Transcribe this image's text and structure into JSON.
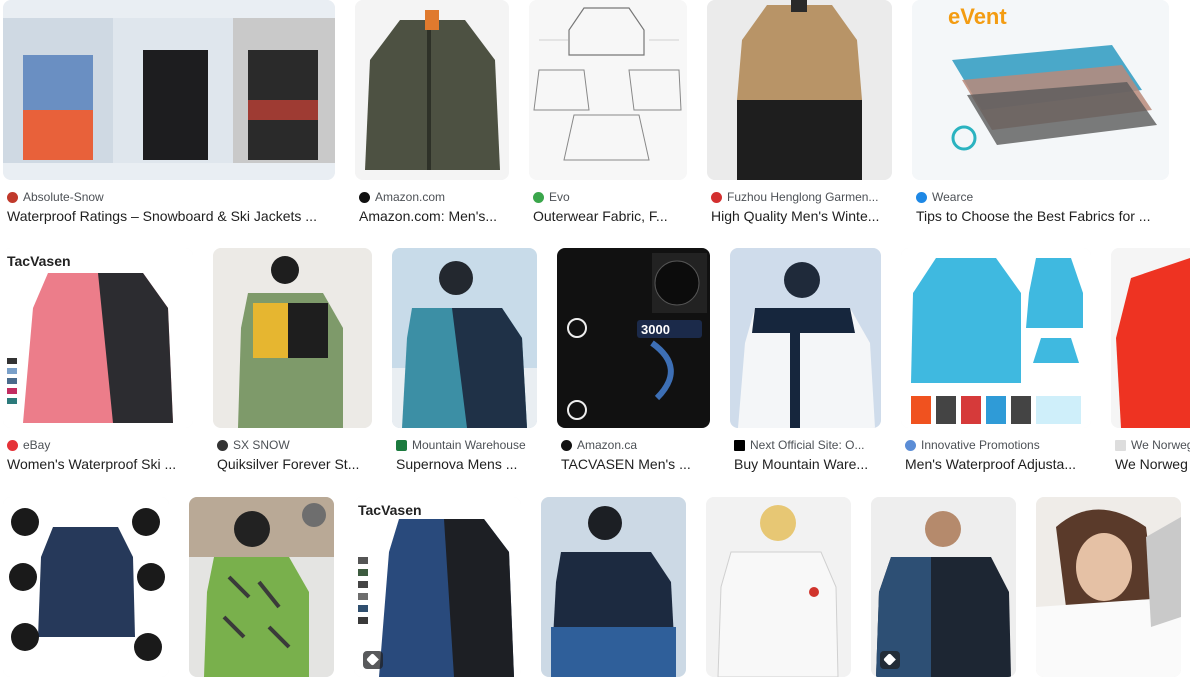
{
  "colors": {
    "background": "#ffffff",
    "source_text": "#4d5156",
    "title_text": "#1f1f1f"
  },
  "results": {
    "row1": [
      {
        "source": "Absolute-Snow",
        "title": "Waterproof Ratings – Snowboard & Ski Jackets ...",
        "favicon_color": "#c0392b"
      },
      {
        "source": "Amazon.com",
        "title": "Amazon.com: Men's...",
        "favicon_color": "#111111"
      },
      {
        "source": "Evo",
        "title": "Outerwear Fabric, F...",
        "favicon_color": "#3aa64b"
      },
      {
        "source": "Fuzhou Henglong Garmen...",
        "title": "High Quality Men's Winte...",
        "favicon_color": "#d32f2f"
      },
      {
        "source": "Wearce",
        "title": "Tips to Choose the Best Fabrics for ...",
        "favicon_color": "#1e88e5"
      }
    ],
    "row2": [
      {
        "source": "eBay",
        "title": "Women's Waterproof Ski ...",
        "favicon_color": "#e53238"
      },
      {
        "source": "SX SNOW",
        "title": "Quiksilver Forever St...",
        "favicon_color": "#333333"
      },
      {
        "source": "Mountain Warehouse",
        "title": "Supernova Mens ...",
        "favicon_color": "#1b7a3e"
      },
      {
        "source": "Amazon.ca",
        "title": "TACVASEN Men's ...",
        "favicon_color": "#111111"
      },
      {
        "source": "Next Official Site: O...",
        "title": "Buy Mountain Ware...",
        "favicon_color": "#000000"
      },
      {
        "source": "Innovative Promotions",
        "title": "Men's Waterproof Adjusta...",
        "favicon_color": "#5b8dd6"
      },
      {
        "source": "We Norweg",
        "title": "We Norweg",
        "favicon_color": "#dddddd"
      }
    ]
  },
  "icons": {
    "product_tag": "tag-icon"
  }
}
